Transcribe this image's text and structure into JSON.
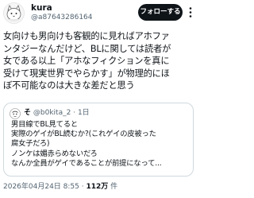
{
  "author": {
    "display_name": "kura",
    "handle": "@a87643286164",
    "avatar_icon": "cat-avatar-icon"
  },
  "follow_button": {
    "label": "フォローする"
  },
  "more_menu_icon": "more-vertical-icon",
  "post": {
    "lines": [
      "女向けも男向けも客観的に見ればアホファ",
      "ンタジーなんだけど、BLに関しては読者が",
      "女である以上「アホなフィクションを真に",
      "受けて現実世界でやらかす」が物理的にほ",
      "ぼ不可能なのは大きな差だと思う"
    ]
  },
  "quote": {
    "avatar_icon": "quote-avatar-icon",
    "name": "そ",
    "handle": "@b0kita_2",
    "separator": "·",
    "time": "1日",
    "lines": [
      "男目線でBL見てると",
      "実際のゲイがBL読むか?(これゲイの皮被った",
      "腐女子だろ)",
      "ノンケは媚赤らめないだろ",
      "なんか全員がゲイであることが前提になって..."
    ]
  },
  "footer": {
    "timestamp": "2026年04月24日 8:55",
    "separator": "·",
    "views_count": "112万",
    "views_label": " 件"
  },
  "colors": {
    "text": "#0f1419",
    "secondary": "#536471",
    "border": "#cfd9de",
    "button_bg": "#0f1419",
    "button_text": "#ffffff"
  }
}
